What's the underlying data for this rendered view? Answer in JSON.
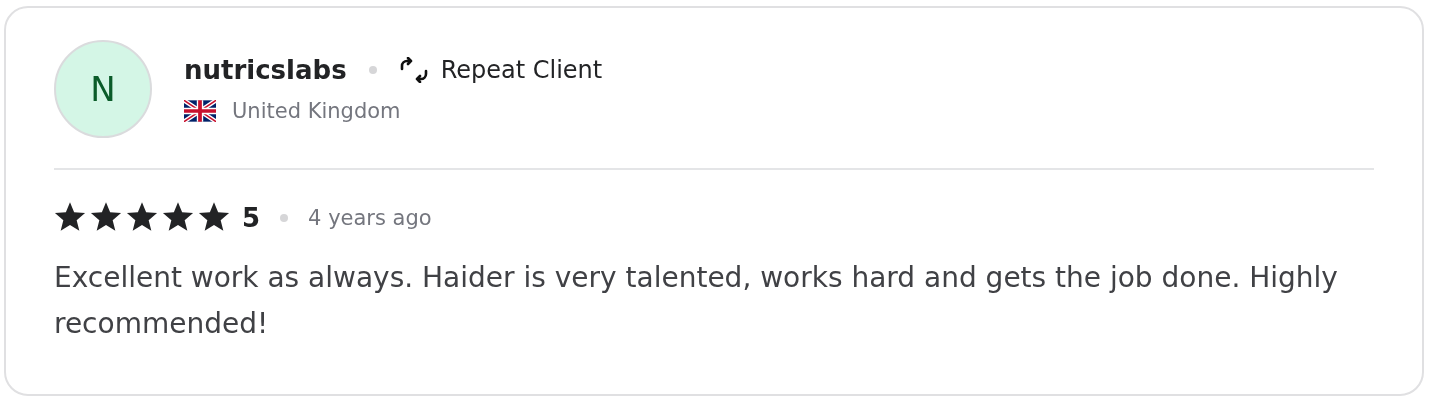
{
  "review": {
    "avatar_initial": "N",
    "username": "nutricslabs",
    "badge": "Repeat Client",
    "country": "United Kingdom",
    "stars": 5,
    "rating": "5",
    "time": "4 years ago",
    "text": "Excellent work as always. Haider is very talented, works hard and gets the job done. Highly recommended!"
  }
}
